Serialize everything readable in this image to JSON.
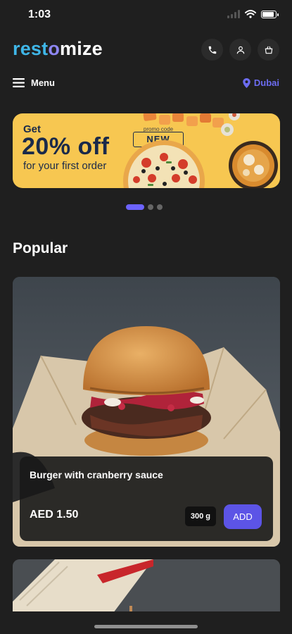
{
  "status": {
    "time": "1:03"
  },
  "logo": {
    "part1": "rest",
    "part2": "o",
    "part3": "mize"
  },
  "header": {
    "icons": [
      "phone-icon",
      "user-icon",
      "cart-icon"
    ]
  },
  "nav": {
    "menu_label": "Menu",
    "location": "Dubai"
  },
  "banner": {
    "get": "Get",
    "offer": "20% off",
    "subtitle": "for your first order",
    "promo_label": "promo code",
    "promo_code": "NEW"
  },
  "carousel": {
    "count": 3,
    "active": 0
  },
  "popular": {
    "title": "Popular",
    "items": [
      {
        "name": "Burger with cranberry sauce",
        "price": "AED 1.50",
        "weight": "300 g",
        "add_label": "ADD"
      }
    ]
  },
  "colors": {
    "background": "#1f1f1f",
    "accent": "#5c54e6",
    "logo_blue": "#3fb6e8",
    "logo_purple": "#8e86f3",
    "banner_yellow": "#f7c751"
  }
}
